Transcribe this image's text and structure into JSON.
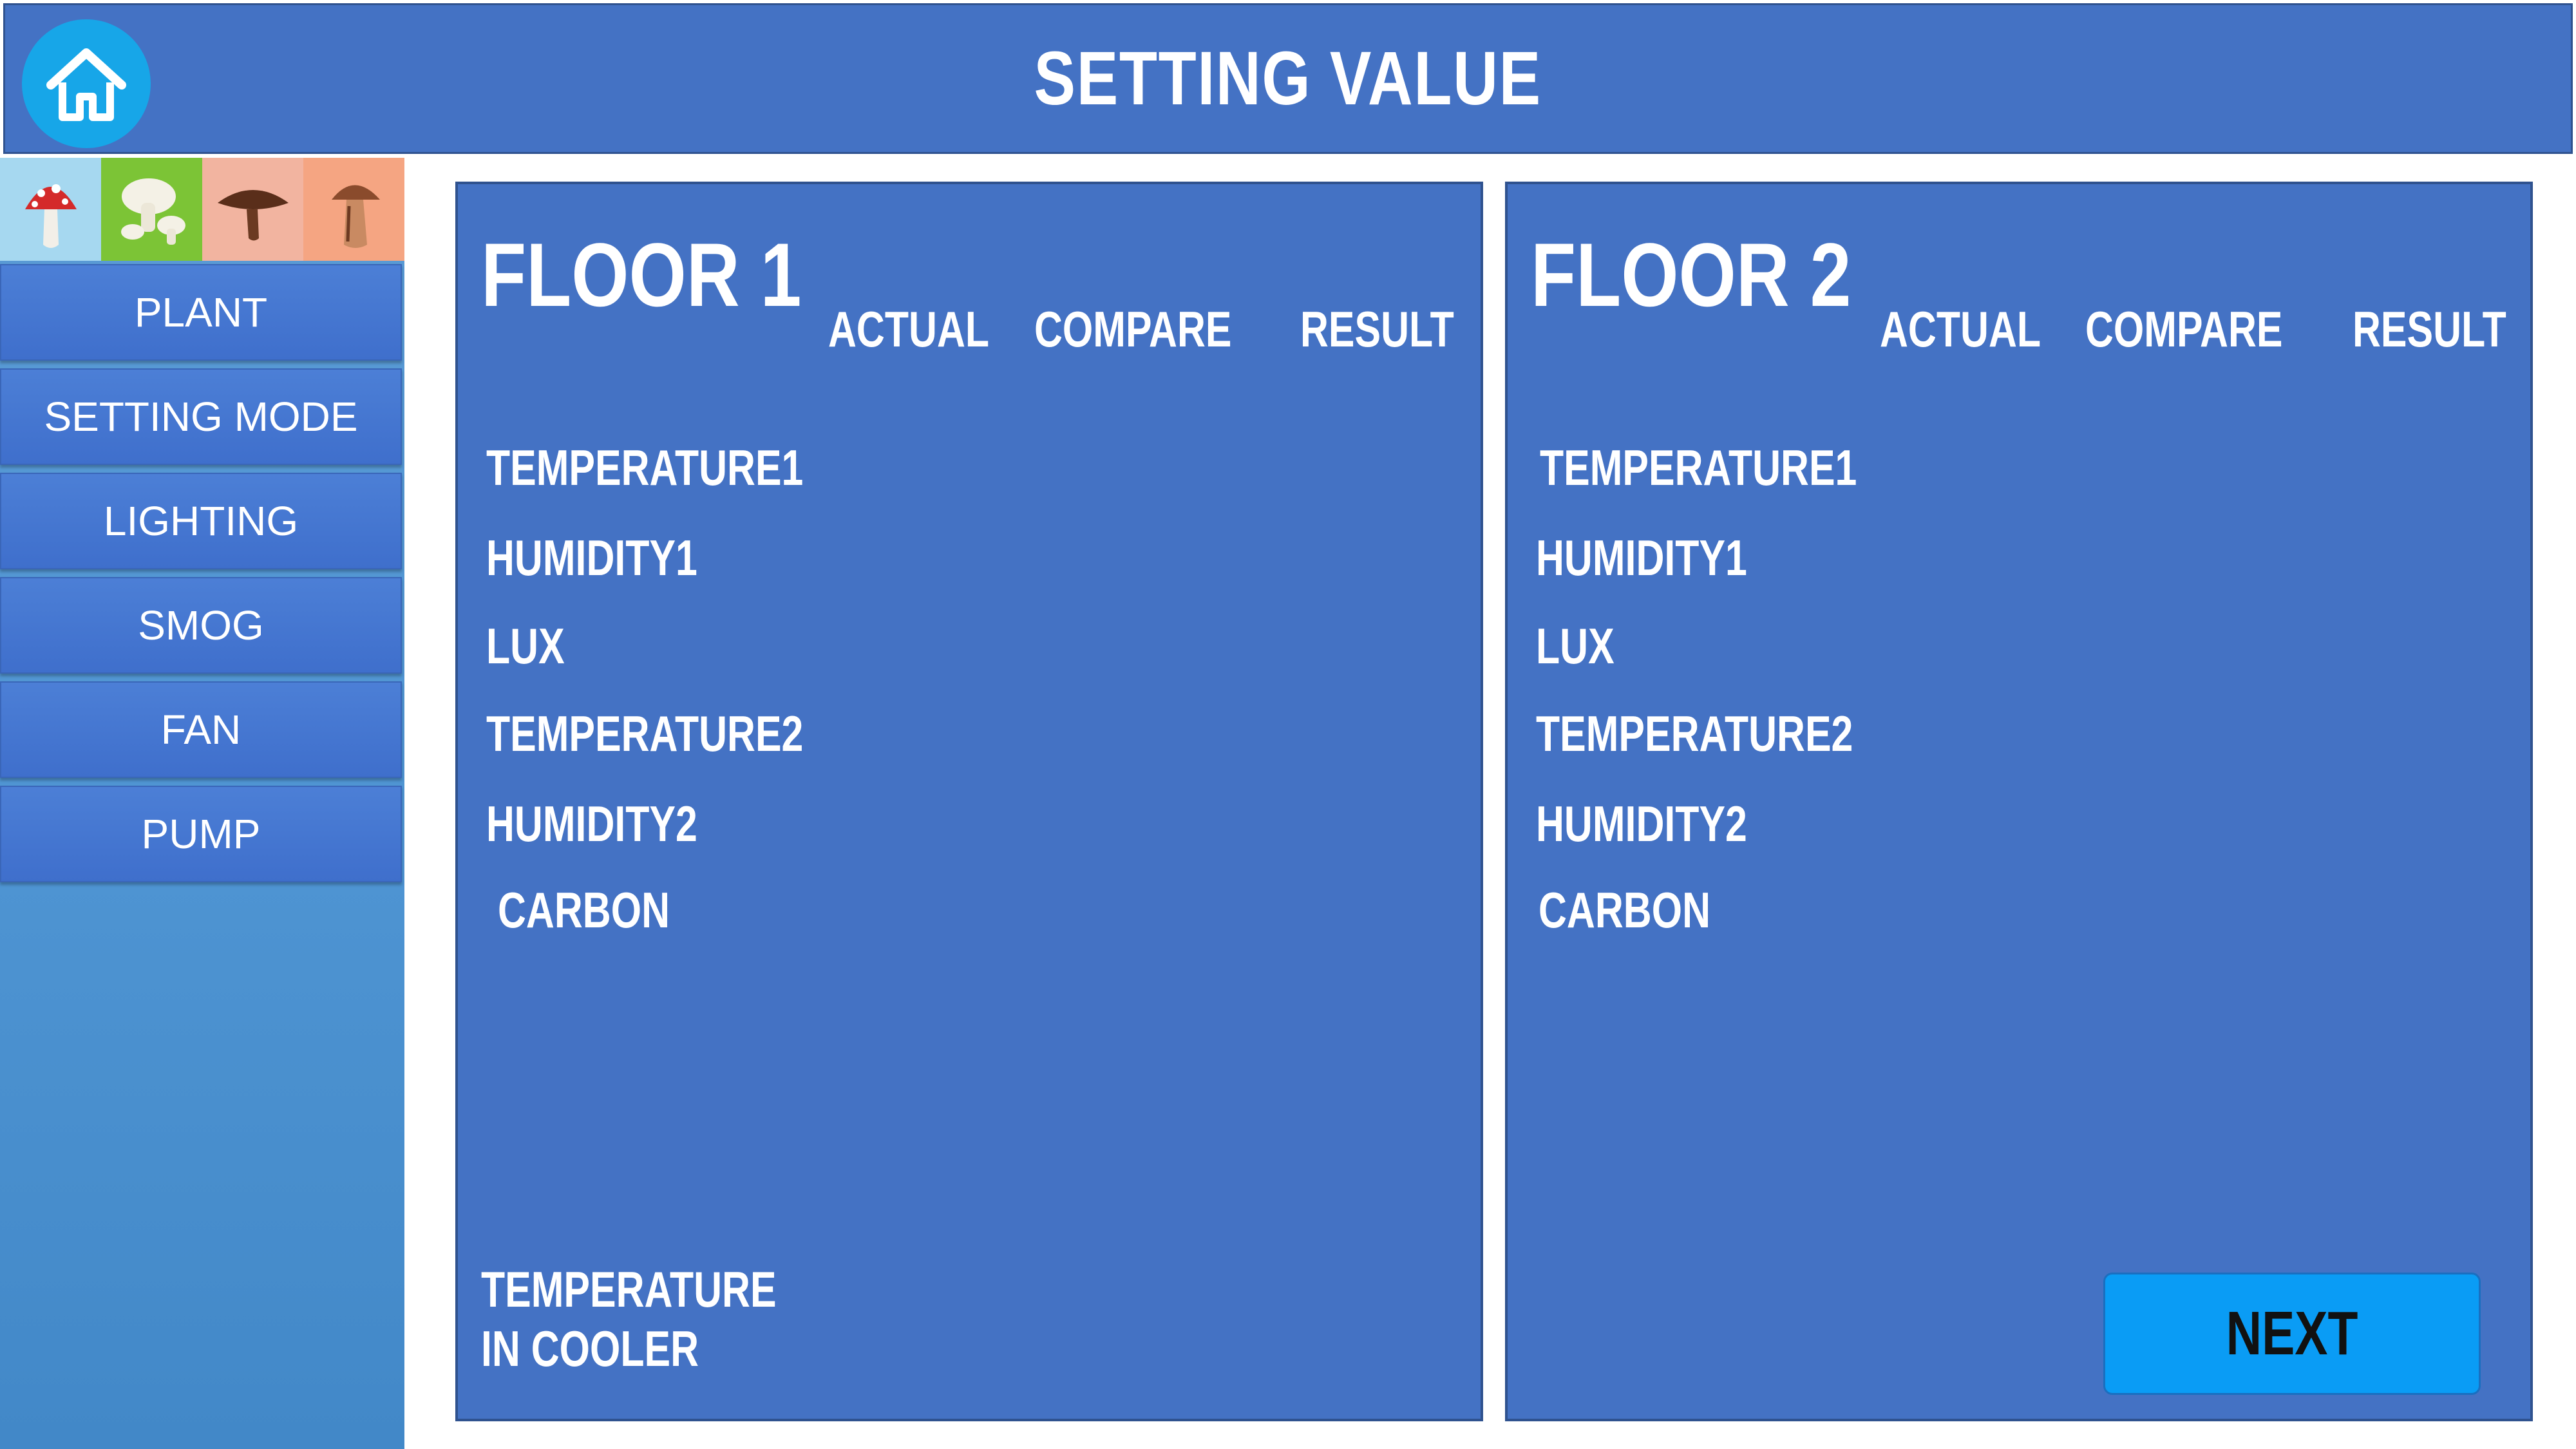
{
  "header": {
    "title": "SETTING VALUE"
  },
  "home": {
    "icon": "home-icon"
  },
  "sidebar": {
    "icons": [
      "amanita-mushroom-icon",
      "white-mushroom-icon",
      "brown-cap-mushroom-icon",
      "porcini-mushroom-icon"
    ],
    "items": [
      {
        "label": "PLANT"
      },
      {
        "label": "SETTING MODE"
      },
      {
        "label": "LIGHTING"
      },
      {
        "label": "SMOG"
      },
      {
        "label": "FAN"
      },
      {
        "label": "PUMP"
      }
    ]
  },
  "floor1": {
    "title": "FLOOR 1",
    "columns": [
      "ACTUAL",
      "COMPARE",
      "RESULT"
    ],
    "rows": [
      "TEMPERATURE1",
      "HUMIDITY1",
      "LUX",
      "TEMPERATURE2",
      "HUMIDITY2",
      "CARBON"
    ],
    "cooler_line1": "TEMPERATURE",
    "cooler_line2": "IN COOLER"
  },
  "floor2": {
    "title": "FLOOR 2",
    "columns": [
      "ACTUAL",
      "COMPARE",
      "RESULT"
    ],
    "rows": [
      "TEMPERATURE1",
      "HUMIDITY1",
      "LUX",
      "TEMPERATURE2",
      "HUMIDITY2",
      "CARBON"
    ]
  },
  "next_label": "NEXT",
  "colors": {
    "header_bg": "#4472c4",
    "panel_bg": "#4472c4",
    "home_button": "#17a6e8",
    "next_button": "#0a9cf5"
  }
}
